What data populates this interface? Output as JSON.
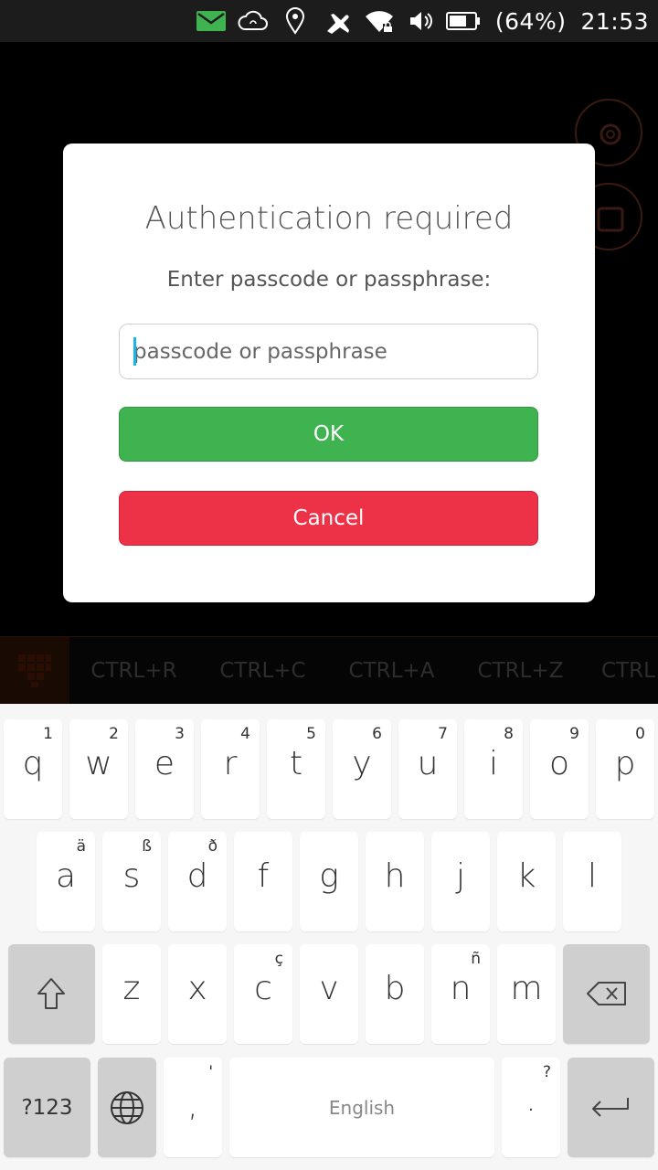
{
  "status_bar": {
    "icons": [
      "mail-icon",
      "cloud-sync-icon",
      "location-icon",
      "airplane-mode-icon",
      "wifi-locked-icon",
      "volume-icon",
      "battery-icon"
    ],
    "battery": "(64%)",
    "time": "21:53",
    "mail_color": "#3eb34f"
  },
  "background_app": {
    "buttons": [
      "gear-icon",
      "window-icon"
    ]
  },
  "toolbar": {
    "items": [
      "CTRL+R",
      "CTRL+C",
      "CTRL+A",
      "CTRL+Z",
      "CTRL"
    ]
  },
  "dialog": {
    "title": "Authentication required",
    "subtitle": "Enter passcode or passphrase:",
    "input_placeholder": "passcode or passphrase",
    "input_value": "",
    "ok_label": "OK",
    "cancel_label": "Cancel",
    "ok_color": "#3eb34f",
    "cancel_color": "#ed3146"
  },
  "keyboard": {
    "row1": [
      {
        "main": "q",
        "sub": "1"
      },
      {
        "main": "w",
        "sub": "2"
      },
      {
        "main": "e",
        "sub": "3"
      },
      {
        "main": "r",
        "sub": "4"
      },
      {
        "main": "t",
        "sub": "5"
      },
      {
        "main": "y",
        "sub": "6"
      },
      {
        "main": "u",
        "sub": "7"
      },
      {
        "main": "i",
        "sub": "8"
      },
      {
        "main": "o",
        "sub": "9"
      },
      {
        "main": "p",
        "sub": "0"
      }
    ],
    "row2": [
      {
        "main": "a",
        "sub": "ä"
      },
      {
        "main": "s",
        "sub": "ß"
      },
      {
        "main": "d",
        "sub": "ð"
      },
      {
        "main": "f",
        "sub": ""
      },
      {
        "main": "g",
        "sub": ""
      },
      {
        "main": "h",
        "sub": ""
      },
      {
        "main": "j",
        "sub": ""
      },
      {
        "main": "k",
        "sub": ""
      },
      {
        "main": "l",
        "sub": ""
      }
    ],
    "row3": [
      {
        "main": "z",
        "sub": ""
      },
      {
        "main": "x",
        "sub": ""
      },
      {
        "main": "c",
        "sub": "ç"
      },
      {
        "main": "v",
        "sub": ""
      },
      {
        "main": "b",
        "sub": ""
      },
      {
        "main": "n",
        "sub": "ñ"
      },
      {
        "main": "m",
        "sub": ""
      }
    ],
    "symbols_label": "?123",
    "comma": {
      "main": ",",
      "sub": "'"
    },
    "space_label": "English",
    "period": {
      "main": ".",
      "sub": "?"
    }
  }
}
